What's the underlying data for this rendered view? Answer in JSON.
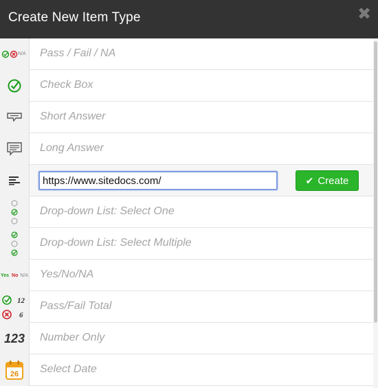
{
  "header": {
    "title": "Create New Item Type"
  },
  "icons": {
    "close": "close-icon"
  },
  "colors": {
    "header_bg": "#333333",
    "accent_green": "#2ab52a",
    "input_border": "#7d9be0"
  },
  "items": [
    {
      "label": "Pass / Fail / NA",
      "icon": "pass-fail-na-icon"
    },
    {
      "label": "Check Box",
      "icon": "checkbox-icon"
    },
    {
      "label": "Short Answer",
      "icon": "short-answer-icon"
    },
    {
      "label": "Long Answer",
      "icon": "long-answer-icon"
    },
    {
      "label": "",
      "icon": "text-lines-icon"
    },
    {
      "label": "Drop-down List: Select One",
      "icon": "dropdown-select-one-icon"
    },
    {
      "label": "Drop-down List: Select Multiple",
      "icon": "dropdown-select-multiple-icon"
    },
    {
      "label": "Yes/No/NA",
      "icon": "yes-no-na-icon"
    },
    {
      "label": "Pass/Fail Total",
      "icon": "pass-fail-total-icon"
    },
    {
      "label": "Number Only",
      "icon": "number-only-icon"
    },
    {
      "label": "Select Date",
      "icon": "calendar-icon"
    }
  ],
  "editor": {
    "value": "https://www.sitedocs.com/",
    "create_label": "Create"
  },
  "icon_text": {
    "na": "N/A",
    "yes": "Yes",
    "no": "No",
    "pass_total": "12",
    "fail_total": "6",
    "number": "123",
    "date": "26"
  }
}
